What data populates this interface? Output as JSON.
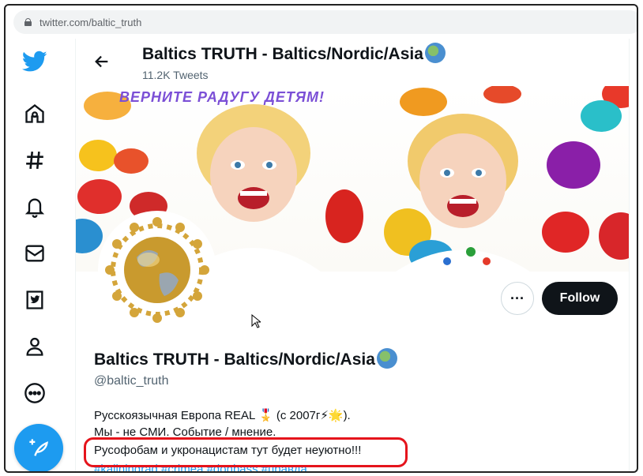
{
  "browser": {
    "url": "twitter.com/baltic_truth"
  },
  "nav": {
    "items": [
      "twitter-logo",
      "home-icon",
      "explore-hashtag-icon",
      "notifications-bell-icon",
      "messages-mail-icon",
      "twitter-blue-icon",
      "profile-person-icon",
      "more-circle-icon"
    ],
    "accent": "#1d9bf0"
  },
  "header": {
    "title": "Baltics TRUTH - Baltics/Nordic/Asia",
    "tweets": "11.2K Tweets"
  },
  "banner": {
    "caption": "ВЕРНИТЕ РАДУГУ ДЕТЯМ!"
  },
  "profile": {
    "name": "Baltics TRUTH - Baltics/Nordic/Asia",
    "handle": "@baltic_truth",
    "more_label": "···",
    "follow_label": "Follow",
    "bio_line1": "Русскоязычная Европа REAL 🎖️ (с 2007г⚡🌟).",
    "bio_line2": "Мы - не СМИ. Событие / мнение.",
    "bio_line3": "Русофобам и укронацистам тут будет неуютно!!!",
    "bio_hashtags": "#kaliningrad #crimea #donbass #правда"
  },
  "colors": {
    "follow_bg": "#0f1419",
    "highlight": "#e5141c",
    "link": "#1d9bf0"
  }
}
